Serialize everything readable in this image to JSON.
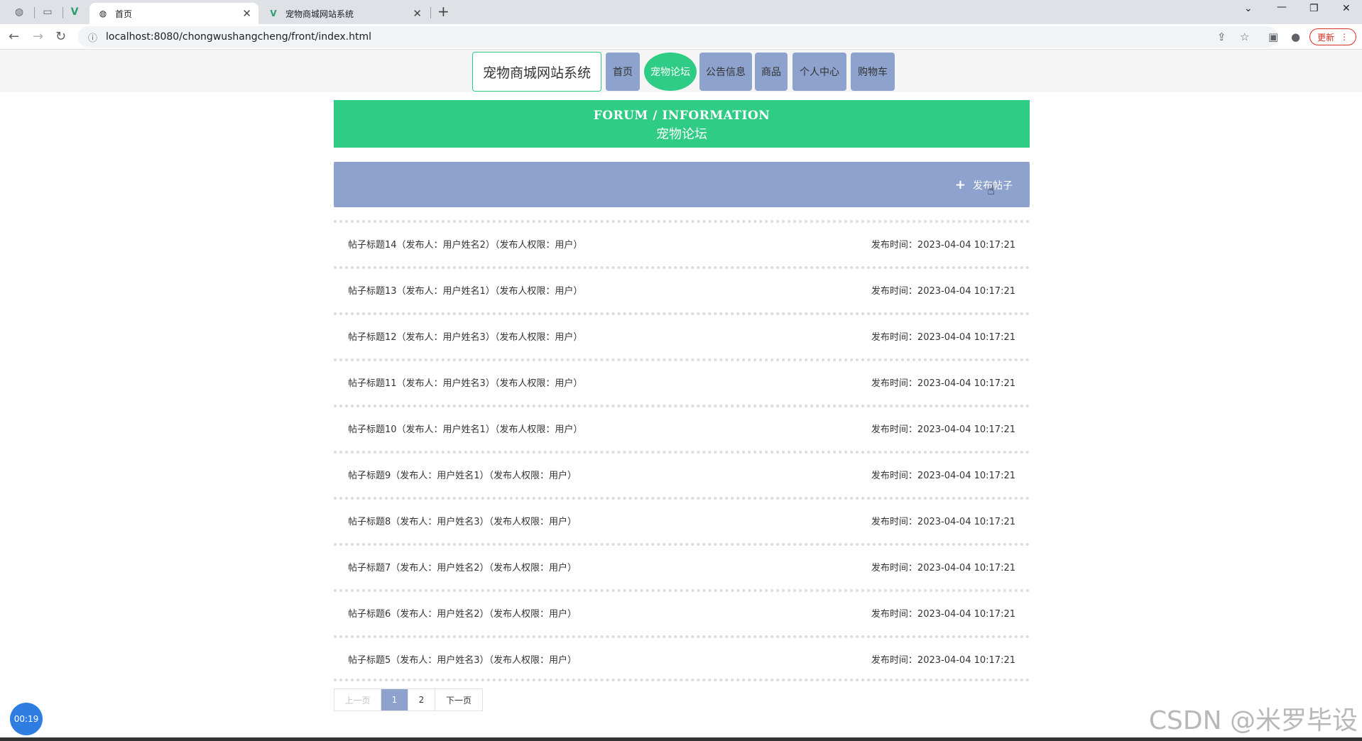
{
  "browser": {
    "tabs": [
      {
        "label": "首页",
        "active": true
      },
      {
        "label": "宠物商城网站系统",
        "active": false
      }
    ],
    "url": "localhost:8080/chongwushangcheng/front/index.html",
    "update_label": "更新"
  },
  "site": {
    "brand": "宠物商城网站系统",
    "nav": [
      {
        "label": "首页",
        "active": false
      },
      {
        "label": "宠物论坛",
        "active": true
      },
      {
        "label": "公告信息",
        "active": false
      },
      {
        "label": "商品",
        "active": false
      },
      {
        "label": "个人中心",
        "active": false
      },
      {
        "label": "购物车",
        "active": false
      }
    ]
  },
  "banner": {
    "en": "FORUM / INFORMATION",
    "cn": "宠物论坛"
  },
  "actions": {
    "post_label": "发布帖子"
  },
  "posts": [
    {
      "title": "帖子标题14（发布人：用户姓名2）（发布人权限：用户）",
      "time": "发布时间：2023-04-04 10:17:21"
    },
    {
      "title": "帖子标题13（发布人：用户姓名1）（发布人权限：用户）",
      "time": "发布时间：2023-04-04 10:17:21"
    },
    {
      "title": "帖子标题12（发布人：用户姓名3）（发布人权限：用户）",
      "time": "发布时间：2023-04-04 10:17:21"
    },
    {
      "title": "帖子标题11（发布人：用户姓名3）（发布人权限：用户）",
      "time": "发布时间：2023-04-04 10:17:21"
    },
    {
      "title": "帖子标题10（发布人：用户姓名1）（发布人权限：用户）",
      "time": "发布时间：2023-04-04 10:17:21"
    },
    {
      "title": "帖子标题9（发布人：用户姓名1）（发布人权限：用户）",
      "time": "发布时间：2023-04-04 10:17:21"
    },
    {
      "title": "帖子标题8（发布人：用户姓名3）（发布人权限：用户）",
      "time": "发布时间：2023-04-04 10:17:21"
    },
    {
      "title": "帖子标题7（发布人：用户姓名2）（发布人权限：用户）",
      "time": "发布时间：2023-04-04 10:17:21"
    },
    {
      "title": "帖子标题6（发布人：用户姓名2）（发布人权限：用户）",
      "time": "发布时间：2023-04-04 10:17:21"
    },
    {
      "title": "帖子标题5（发布人：用户姓名3）（发布人权限：用户）",
      "time": "发布时间：2023-04-04 10:17:21"
    }
  ],
  "pager": {
    "prev": "上一页",
    "pages": [
      "1",
      "2"
    ],
    "current": "1",
    "next": "下一页"
  },
  "overlay": {
    "timer": "00:19",
    "watermark": "CSDN @米罗毕设"
  },
  "colors": {
    "accent_green": "#2ecc84",
    "nav_blue": "#8da2cc"
  }
}
